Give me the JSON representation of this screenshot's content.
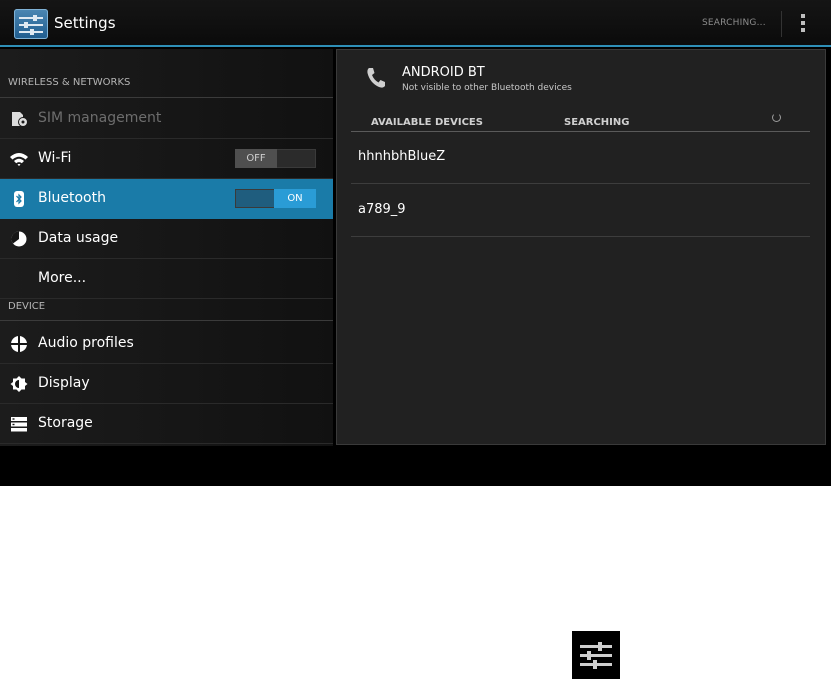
{
  "actionbar": {
    "title": "Settings",
    "status": "SEARCHING..."
  },
  "sidebar": {
    "categories": {
      "wireless": "WIRELESS & NETWORKS",
      "device": "DEVICE"
    },
    "items": [
      {
        "label": "SIM management",
        "icon": "sim-icon",
        "state": "disabled"
      },
      {
        "label": "Wi-Fi",
        "icon": "wifi-icon",
        "toggle": "OFF"
      },
      {
        "label": "Bluetooth",
        "icon": "bluetooth-icon",
        "toggle": "ON",
        "state": "selected"
      },
      {
        "label": "Data usage",
        "icon": "data-usage-icon"
      },
      {
        "label": "More..."
      },
      {
        "label": "Audio profiles",
        "icon": "audio-profiles-icon"
      },
      {
        "label": "Display",
        "icon": "display-icon"
      },
      {
        "label": "Storage",
        "icon": "storage-icon"
      }
    ]
  },
  "bluetooth": {
    "device_name": "ANDROID BT",
    "visibility": "Not visible to other Bluetooth devices",
    "header_available": "AVAILABLE DEVICES",
    "header_status": "SEARCHING",
    "devices": [
      "hhnhbhBlueZ",
      "a789_9"
    ]
  },
  "colors": {
    "accent": "#2e8fb7",
    "selected": "#1a7ba8"
  }
}
